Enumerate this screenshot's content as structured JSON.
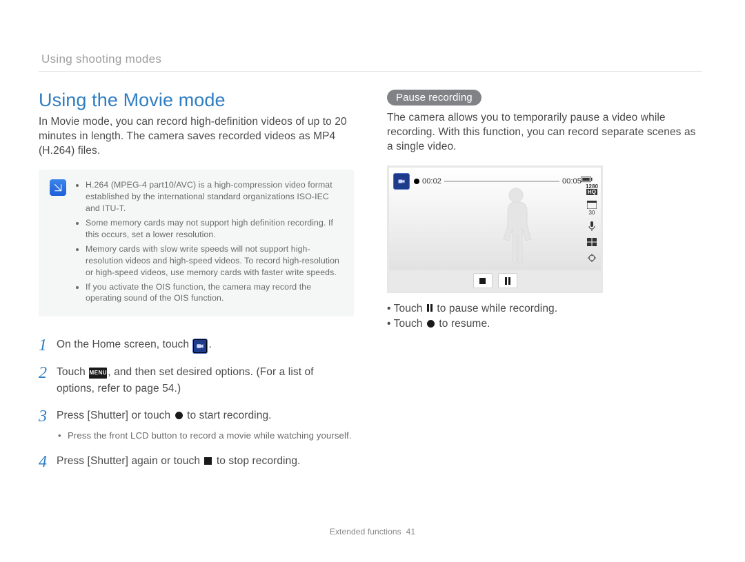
{
  "header": {
    "section": "Using shooting modes"
  },
  "left": {
    "title": "Using the Movie mode",
    "intro": "In Movie mode, you can record high-definition videos of up to 20 minutes in length. The camera saves recorded videos as MP4 (H.264) files.",
    "notes": [
      "H.264 (MPEG-4 part10/AVC) is a high-compression video format established by the international standard organizations ISO-IEC and ITU-T.",
      "Some memory cards may not support high definition recording. If this occurs, set a lower resolution.",
      "Memory cards with slow write speeds will not support high-resolution videos and high-speed videos. To record high-resolution or high-speed videos, use memory cards with faster write speeds.",
      "If you activate the OIS function, the camera may record the operating sound of the OIS function."
    ],
    "steps": {
      "s1": {
        "num": "1",
        "a": "On the Home screen, touch ",
        "b": "."
      },
      "s2": {
        "num": "2",
        "a": "Touch ",
        "menu": "MENU",
        "b": ", and then set desired options. (For a list of options, refer to page 54.)"
      },
      "s3": {
        "num": "3",
        "a": "Press [",
        "shutter": "Shutter",
        "b": "] or touch ",
        "c": " to start recording.",
        "sub": "Press the front LCD button to record a movie while watching yourself."
      },
      "s4": {
        "num": "4",
        "a": "Press [",
        "shutter": "Shutter",
        "b": "] again or touch ",
        "c": " to stop recording."
      }
    }
  },
  "right": {
    "pill": "Pause recording",
    "para": "The camera allows you to temporarily pause a video while recording. With this function, you can record separate scenes as a single video.",
    "shot": {
      "t1": "00:02",
      "t2": "00:05",
      "res": "1280",
      "hq": "HQ",
      "fps": "30"
    },
    "b1a": "Touch ",
    "b1b": " to pause while recording.",
    "b2a": "Touch ",
    "b2b": " to resume."
  },
  "footer": {
    "label": "Extended functions",
    "page": "41"
  }
}
